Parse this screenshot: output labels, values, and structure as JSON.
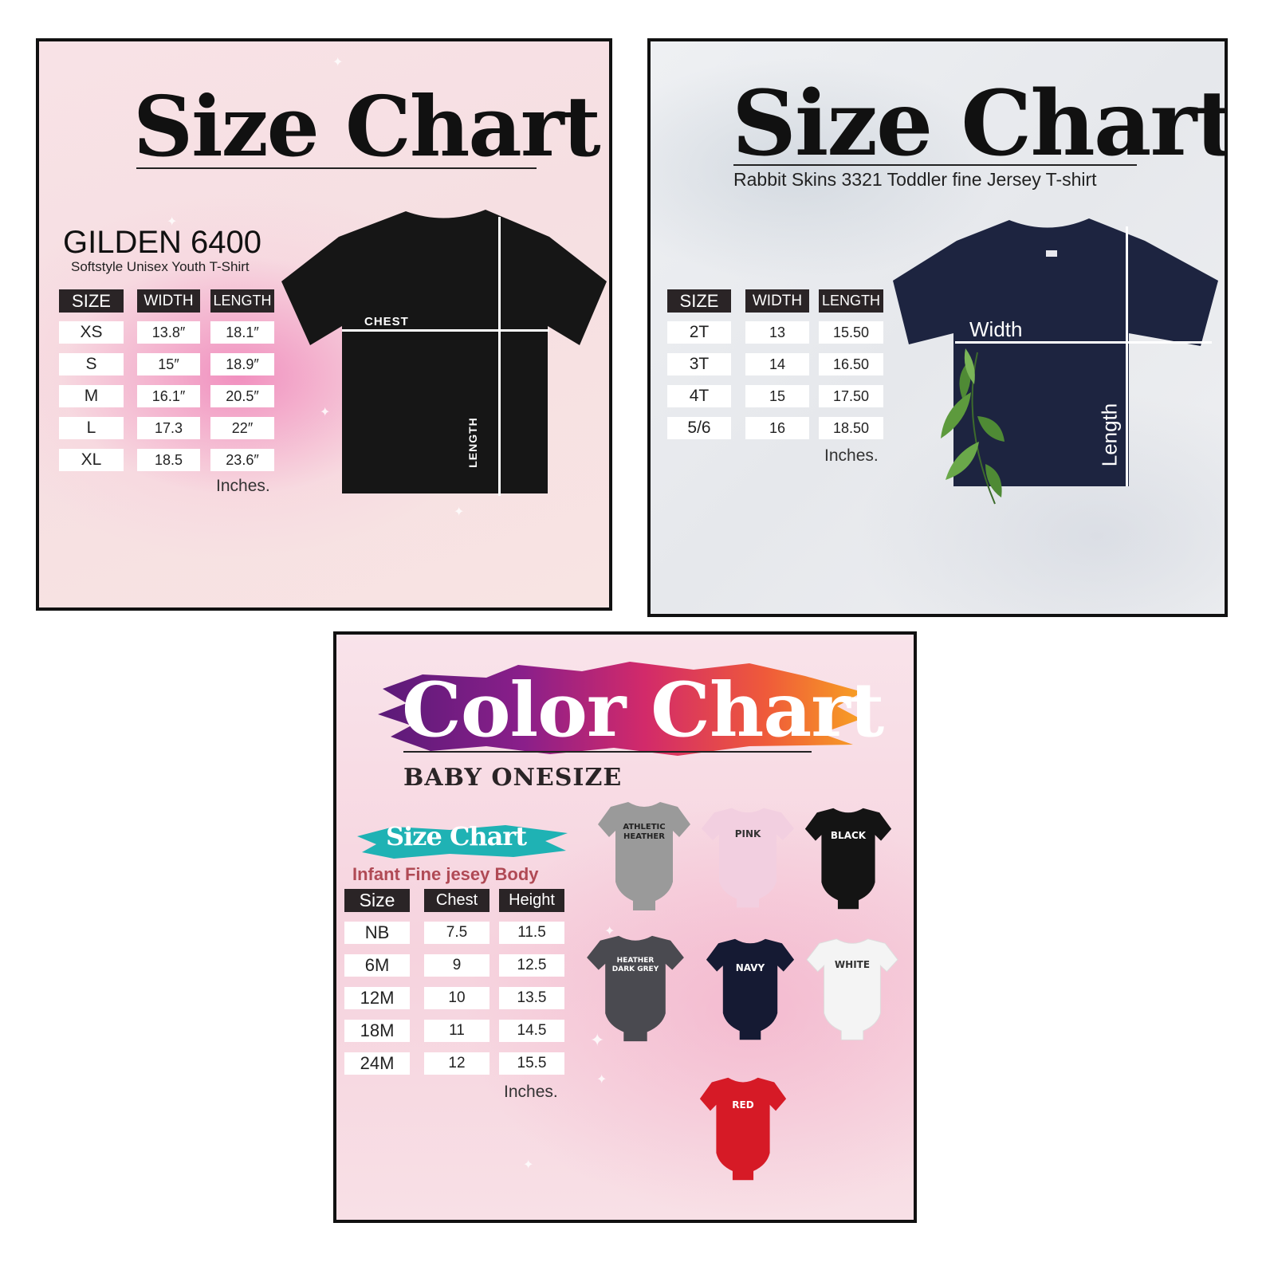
{
  "panel_gildan": {
    "title": "Size Chart",
    "brand": "GILDEN 6400",
    "subtitle": "Softstyle Unisex Youth T-Shirt",
    "headers": [
      "SIZE",
      "WIDTH",
      "LENGTH"
    ],
    "rows": [
      [
        "XS",
        "13.8″",
        "18.1″"
      ],
      [
        "S",
        "15″",
        "18.9″"
      ],
      [
        "M",
        "16.1″",
        "20.5″"
      ],
      [
        "L",
        "17.3",
        "22″"
      ],
      [
        "XL",
        "18.5",
        "23.6″"
      ]
    ],
    "unit_note": "Inches.",
    "shirt_color": "#161616",
    "chest_label": "CHEST",
    "length_label": "LENGTH"
  },
  "panel_rabbit": {
    "title": "Size Chart",
    "subtitle": "Rabbit Skins 3321 Toddler fine Jersey T-shirt",
    "headers": [
      "SIZE",
      "WIDTH",
      "LENGTH"
    ],
    "rows": [
      [
        "2T",
        "13",
        "15.50"
      ],
      [
        "3T",
        "14",
        "16.50"
      ],
      [
        "4T",
        "15",
        "17.50"
      ],
      [
        "5/6",
        "16",
        "18.50"
      ]
    ],
    "unit_note": "Inches.",
    "shirt_color": "#1d2440",
    "width_label": "Width",
    "length_label": "Length"
  },
  "panel_color": {
    "title": "Color Chart",
    "subtitle": "BABY ONESIZE",
    "size_chart_label": "Size Chart",
    "product": "Infant Fine jesey Body",
    "headers": [
      "Size",
      "Chest",
      "Height"
    ],
    "rows": [
      [
        "NB",
        "7.5",
        "11.5"
      ],
      [
        "6M",
        "9",
        "12.5"
      ],
      [
        "12M",
        "10",
        "13.5"
      ],
      [
        "18M",
        "11",
        "14.5"
      ],
      [
        "24M",
        "12",
        "15.5"
      ]
    ],
    "unit_note": "Inches.",
    "colors": [
      {
        "name": "ATHLETIC\nHEATHER",
        "hex": "#9a9a9a",
        "text": "#222222"
      },
      {
        "name": "PINK",
        "hex": "#f2cfe0",
        "text": "#333333"
      },
      {
        "name": "BLACK",
        "hex": "#141414",
        "text": "#ffffff"
      },
      {
        "name": "HEATHER\nDARK GREY",
        "hex": "#4a4a50",
        "text": "#ffffff"
      },
      {
        "name": "NAVY",
        "hex": "#151a33",
        "text": "#ffffff"
      },
      {
        "name": "WHITE",
        "hex": "#f4f4f4",
        "text": "#333333"
      },
      {
        "name": "RED",
        "hex": "#d61a26",
        "text": "#ffffff"
      }
    ]
  }
}
